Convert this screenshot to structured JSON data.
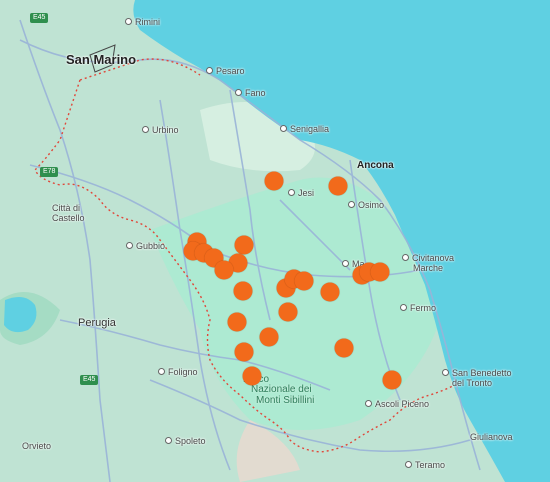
{
  "map": {
    "labels": {
      "rimini": "Rimini",
      "san_marino": "San Marino",
      "pesaro": "Pesaro",
      "fano": "Fano",
      "urbino": "Urbino",
      "senigallia": "Senigallia",
      "ancona": "Ancona",
      "jesi": "Jesi",
      "osimo": "Osimo",
      "citta_di_castello_1": "Città di",
      "citta_di_castello_2": "Castello",
      "gubbio": "Gubbio",
      "civitanova_1": "Civitanova",
      "civitanova_2": "Marche",
      "macerata_partial": "Ma",
      "fermo": "Fermo",
      "perugia": "Perugia",
      "foligno": "Foligno",
      "park_1": "Parco",
      "park_2": "Nazionale dei",
      "park_3": "Monti Sibillini",
      "san_benedetto_1": "San Benedetto",
      "san_benedetto_2": "del Tronto",
      "ascoli": "Ascoli Piceno",
      "spoleto": "Spoleto",
      "orvieto": "Orvieto",
      "giulianova": "Giulianova",
      "teramo": "Teramo"
    },
    "roads": {
      "e45_top": "E45",
      "e78": "E78",
      "e45_bottom": "E45"
    },
    "colors": {
      "sea": "#5fd0e2",
      "land": "#bfe3d3",
      "marker": "#f26a1b",
      "boundary": "#e0473a",
      "road": "#9ab4d8"
    },
    "marker_count": 27
  }
}
